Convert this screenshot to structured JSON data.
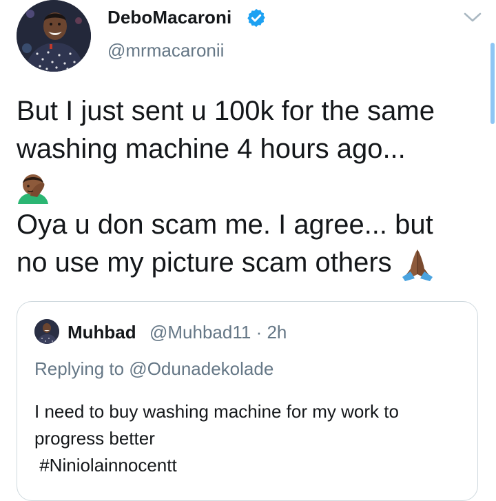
{
  "tweet": {
    "author_name": "DeboMacaroni",
    "author_handle": "@mrmacaronii",
    "verified": true,
    "text_lines": [
      "But I just sent u 100k for the same",
      "washing machine 4 hours ago...",
      "",
      "Oya u don scam me. I agree... but",
      "no use my picture scam others "
    ],
    "emojis": [
      "facepalm-emoji",
      "folded-hands-emoji"
    ]
  },
  "quoted_tweet": {
    "author_name": "Muhbad",
    "author_handle_time": "@Muhbad11 · 2h",
    "replying_to": "Replying to @Odunadekolade",
    "text_lines": [
      "I need to buy washing machine for my work to",
      "progress better",
      " #Niniolainnocentt"
    ]
  },
  "icons": {
    "verified": "verified-badge-icon",
    "menu": "chevron-down-icon"
  },
  "colors": {
    "text": "#14171a",
    "secondary": "#657786",
    "verified": "#1da1f2",
    "border": "#cfd9de",
    "scroll_indicator": "#8ec6f4"
  }
}
